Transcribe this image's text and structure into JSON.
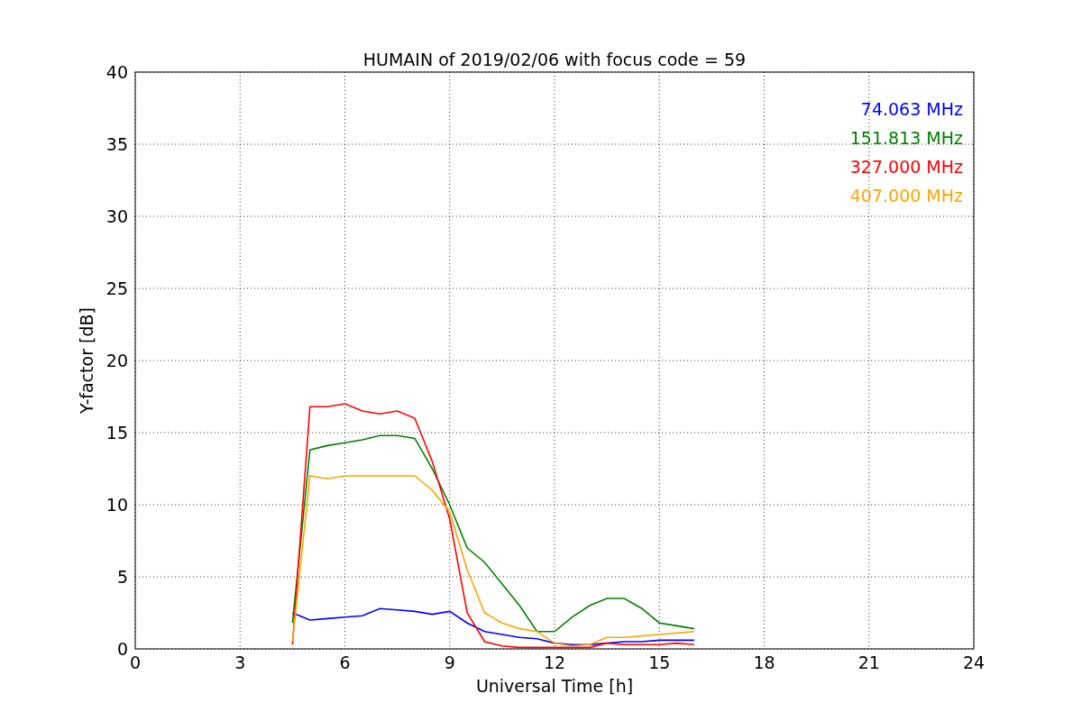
{
  "chart_data": {
    "type": "line",
    "title": "HUMAIN of 2019/02/06 with focus code = 59",
    "xlabel": "Universal Time [h]",
    "ylabel": "Y-factor [dB]",
    "x": [
      4.5,
      5,
      5.5,
      6,
      6.5,
      7,
      7.5,
      8,
      8.5,
      9,
      9.5,
      10,
      10.5,
      11,
      11.5,
      12,
      12.5,
      13,
      13.5,
      14,
      14.5,
      15,
      15.5,
      16
    ],
    "series": [
      {
        "name": "74.063 MHz",
        "color": "#0000ff",
        "values": [
          2.5,
          2.0,
          2.1,
          2.2,
          2.3,
          2.8,
          2.7,
          2.6,
          2.4,
          2.6,
          1.8,
          1.2,
          1.0,
          0.8,
          0.7,
          0.4,
          0.3,
          0.3,
          0.4,
          0.5,
          0.5,
          0.6,
          0.6,
          0.6
        ]
      },
      {
        "name": "151.813 MHz",
        "color": "#008000",
        "values": [
          1.8,
          13.8,
          14.1,
          14.3,
          14.5,
          14.8,
          14.8,
          14.6,
          12.5,
          10.0,
          7.0,
          6.0,
          4.5,
          3.0,
          1.2,
          1.2,
          2.2,
          3.0,
          3.5,
          3.5,
          2.8,
          1.8,
          1.6,
          1.4
        ]
      },
      {
        "name": "327.000 MHz",
        "color": "#ff0000",
        "values": [
          0.3,
          16.8,
          16.8,
          17.0,
          16.5,
          16.3,
          16.5,
          16.0,
          13.0,
          9.0,
          2.5,
          0.5,
          0.2,
          0.1,
          0.1,
          0.1,
          0.1,
          0.1,
          0.4,
          0.3,
          0.3,
          0.3,
          0.4,
          0.3
        ]
      },
      {
        "name": "407.000 MHz",
        "color": "#ffa500",
        "values": [
          0.5,
          12.0,
          11.8,
          12.0,
          12.0,
          12.0,
          12.0,
          12.0,
          11.0,
          9.5,
          5.5,
          2.5,
          1.8,
          1.4,
          1.2,
          0.4,
          0.2,
          0.3,
          0.8,
          0.8,
          0.9,
          1.0,
          1.1,
          1.2
        ]
      }
    ],
    "grid": true,
    "xlim": [
      0,
      24
    ],
    "ylim": [
      0,
      40
    ],
    "xticks": [
      0,
      3,
      6,
      9,
      12,
      15,
      18,
      21,
      24
    ],
    "yticks": [
      0,
      5,
      10,
      15,
      20,
      25,
      30,
      35,
      40
    ]
  }
}
